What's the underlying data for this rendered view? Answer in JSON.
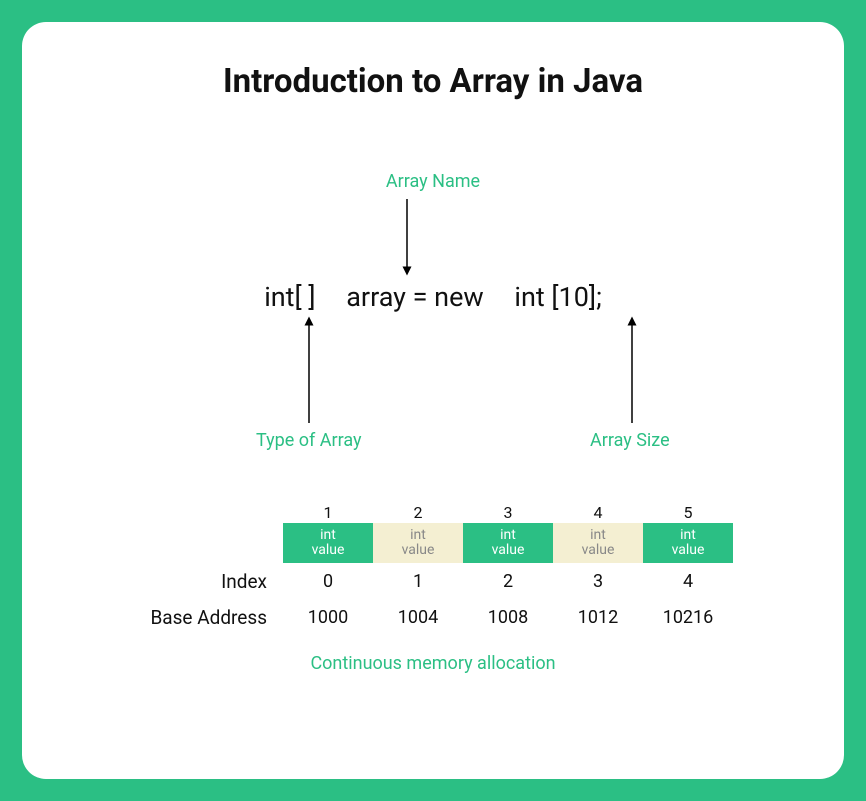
{
  "title": "Introduction to Array in Java",
  "labels": {
    "array_name": "Array Name",
    "type_of_array": "Type of Array",
    "array_size": "Array Size"
  },
  "code": {
    "type_part": "int[ ]",
    "name_new_part": "array = new",
    "size_part": "int [10];"
  },
  "memory": {
    "index_label": "Index",
    "address_label": "Base Address",
    "cell_label_line1": "int",
    "cell_label_line2": "value",
    "cells": [
      {
        "position": "1",
        "index": "0",
        "address": "1000",
        "fill": "green"
      },
      {
        "position": "2",
        "index": "1",
        "address": "1004",
        "fill": "cream"
      },
      {
        "position": "3",
        "index": "2",
        "address": "1008",
        "fill": "green"
      },
      {
        "position": "4",
        "index": "3",
        "address": "1012",
        "fill": "cream"
      },
      {
        "position": "5",
        "index": "4",
        "address": "10216",
        "fill": "green"
      }
    ],
    "footer": "Continuous memory allocation"
  }
}
